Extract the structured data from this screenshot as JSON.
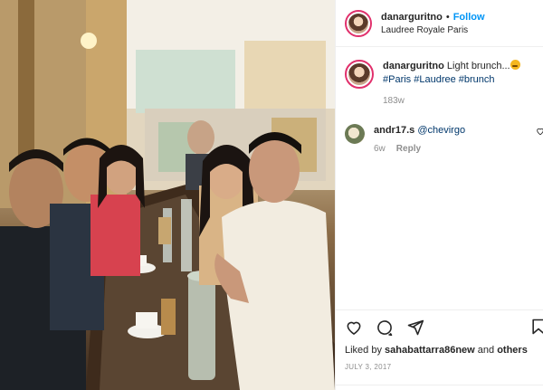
{
  "post": {
    "username": "danarguritno",
    "dot": "•",
    "follow_label": "Follow",
    "location": "Laudree Royale Paris",
    "caption_text": "Light brunch...",
    "caption_tags": "#Paris #Laudree #brunch",
    "caption_time": "183w",
    "photo_alt": "group photo at brunch table"
  },
  "comment": {
    "username": "andr17.s",
    "text": "@chevirgo",
    "time": "6w",
    "reply_label": "Reply"
  },
  "footer": {
    "liked_by_prefix": "Liked by",
    "liked_by_user": "sahabattarra86new",
    "liked_by_suffix": "and",
    "liked_by_others": "others",
    "date": "JULY 3, 2017"
  },
  "colors": {
    "follow": "#0095f6",
    "hashtag": "#00376b",
    "muted": "#8e8e8e",
    "ring": "#e1306c"
  },
  "icons": [
    "heart-icon",
    "comment-icon",
    "share-icon",
    "bookmark-icon"
  ]
}
